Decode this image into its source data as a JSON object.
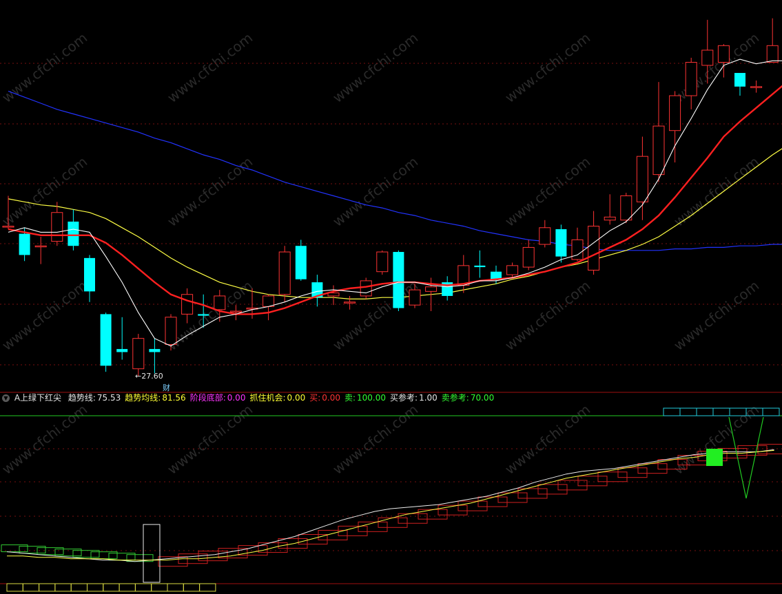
{
  "indicator": {
    "name": "A上绿下红尖",
    "items": [
      {
        "label": "趋势线:",
        "value": "75.53",
        "color": "#e6e6e6"
      },
      {
        "label": "趋势均线:",
        "value": "81.56",
        "color": "#ffff33"
      },
      {
        "label": "阶段底部:",
        "value": "0.00",
        "color": "#ff33ff"
      },
      {
        "label": "抓住机会:",
        "value": "0.00",
        "color": "#ffff33"
      },
      {
        "label": "买:",
        "value": "0.00",
        "color": "#ff3333"
      },
      {
        "label": "卖:",
        "value": "100.00",
        "color": "#33ff33"
      },
      {
        "label": "买参考:",
        "value": "1.00",
        "color": "#e6e6e6"
      },
      {
        "label": "卖参考:",
        "value": "70.00",
        "color": "#33ff33"
      }
    ]
  },
  "annotations": {
    "low_label": "←27.60",
    "finance_marker": "财"
  },
  "watermark": "www.cfchi.com",
  "colors": {
    "up": "#ff3333",
    "down": "#00ffff",
    "ma_fast": "#ffffff",
    "ma_mid": "#ff2020",
    "ma_slow": "#ffff44",
    "ma_long": "#2233ff",
    "grid": "#7a1010"
  },
  "chart_data": [
    {
      "type": "candlestick",
      "title": "",
      "y_range": [
        27.0,
        51.5
      ],
      "low_annotation": 27.6,
      "candles": [
        {
          "o": 37.5,
          "c": 37.5,
          "h": 39.5,
          "l": 37.3
        },
        {
          "o": 37.0,
          "c": 35.6,
          "h": 37.4,
          "l": 35.2
        },
        {
          "o": 36.2,
          "c": 36.2,
          "h": 36.8,
          "l": 35.0
        },
        {
          "o": 36.5,
          "c": 38.4,
          "h": 39.1,
          "l": 36.2
        },
        {
          "o": 37.8,
          "c": 36.2,
          "h": 38.6,
          "l": 35.9
        },
        {
          "o": 35.4,
          "c": 33.2,
          "h": 35.6,
          "l": 32.5
        },
        {
          "o": 31.7,
          "c": 28.3,
          "h": 31.8,
          "l": 27.9
        },
        {
          "o": 29.4,
          "c": 29.2,
          "h": 31.5,
          "l": 28.7
        },
        {
          "o": 28.1,
          "c": 30.1,
          "h": 30.4,
          "l": 27.6
        },
        {
          "o": 29.4,
          "c": 29.2,
          "h": 30.1,
          "l": 27.8
        },
        {
          "o": 29.7,
          "c": 31.5,
          "h": 31.7,
          "l": 29.3
        },
        {
          "o": 31.7,
          "c": 33.0,
          "h": 33.4,
          "l": 31.1
        },
        {
          "o": 31.7,
          "c": 31.6,
          "h": 33.0,
          "l": 30.8
        },
        {
          "o": 32.0,
          "c": 32.9,
          "h": 33.3,
          "l": 31.2
        },
        {
          "o": 31.9,
          "c": 31.9,
          "h": 32.3,
          "l": 31.3
        },
        {
          "o": 32.1,
          "c": 32.1,
          "h": 33.4,
          "l": 31.4
        },
        {
          "o": 32.2,
          "c": 32.9,
          "h": 33.0,
          "l": 31.3
        },
        {
          "o": 33.0,
          "c": 35.8,
          "h": 36.2,
          "l": 32.5
        },
        {
          "o": 36.2,
          "c": 34.0,
          "h": 36.6,
          "l": 33.9
        },
        {
          "o": 33.8,
          "c": 32.8,
          "h": 34.3,
          "l": 32.2
        },
        {
          "o": 32.9,
          "c": 33.1,
          "h": 33.6,
          "l": 32.3
        },
        {
          "o": 32.5,
          "c": 32.5,
          "h": 32.9,
          "l": 32.0
        },
        {
          "o": 32.9,
          "c": 33.9,
          "h": 34.1,
          "l": 32.7
        },
        {
          "o": 34.5,
          "c": 35.8,
          "h": 35.9,
          "l": 34.3
        },
        {
          "o": 35.8,
          "c": 32.1,
          "h": 35.9,
          "l": 31.9
        },
        {
          "o": 32.3,
          "c": 33.3,
          "h": 33.7,
          "l": 32.1
        },
        {
          "o": 33.2,
          "c": 33.5,
          "h": 34.1,
          "l": 31.9
        },
        {
          "o": 33.8,
          "c": 32.9,
          "h": 34.2,
          "l": 32.6
        },
        {
          "o": 33.6,
          "c": 34.9,
          "h": 35.6,
          "l": 33.1
        },
        {
          "o": 34.9,
          "c": 34.8,
          "h": 35.9,
          "l": 34.1
        },
        {
          "o": 34.5,
          "c": 34.0,
          "h": 34.9,
          "l": 33.7
        },
        {
          "o": 34.3,
          "c": 34.9,
          "h": 35.1,
          "l": 34.1
        },
        {
          "o": 34.8,
          "c": 36.1,
          "h": 36.6,
          "l": 34.6
        },
        {
          "o": 36.3,
          "c": 37.4,
          "h": 37.9,
          "l": 36.1
        },
        {
          "o": 37.3,
          "c": 35.5,
          "h": 37.6,
          "l": 35.1
        },
        {
          "o": 35.3,
          "c": 36.6,
          "h": 37.4,
          "l": 35.2
        },
        {
          "o": 34.6,
          "c": 37.5,
          "h": 38.5,
          "l": 34.3
        },
        {
          "o": 37.9,
          "c": 38.1,
          "h": 39.6,
          "l": 37.6
        },
        {
          "o": 37.9,
          "c": 39.5,
          "h": 39.7,
          "l": 37.7
        },
        {
          "o": 39.1,
          "c": 42.1,
          "h": 43.4,
          "l": 37.9
        },
        {
          "o": 40.9,
          "c": 44.1,
          "h": 47.0,
          "l": 40.4
        },
        {
          "o": 43.8,
          "c": 46.1,
          "h": 46.4,
          "l": 41.7
        },
        {
          "o": 46.1,
          "c": 48.3,
          "h": 48.6,
          "l": 45.2
        },
        {
          "o": 48.1,
          "c": 49.1,
          "h": 51.1,
          "l": 46.9
        },
        {
          "o": 48.3,
          "c": 49.4,
          "h": 49.5,
          "l": 47.3
        },
        {
          "o": 47.6,
          "c": 46.7,
          "h": 47.5,
          "l": 46.1
        },
        {
          "o": 46.7,
          "c": 46.7,
          "h": 47.1,
          "l": 46.3
        },
        {
          "o": 48.3,
          "c": 49.4,
          "h": 51.2,
          "l": 48.3
        },
        {
          "o": 48.9,
          "c": 48.7,
          "h": 48.9,
          "l": 48.3
        }
      ],
      "ma_fast": [
        37.1,
        37.4,
        37.1,
        37.1,
        37.3,
        37.1,
        35.5,
        33.8,
        31.8,
        30.1,
        29.6,
        30.3,
        30.9,
        31.5,
        31.7,
        32.0,
        32.2,
        32.5,
        32.9,
        33.2,
        33.3,
        33.2,
        33.1,
        33.5,
        33.8,
        33.8,
        33.6,
        33.5,
        33.6,
        33.9,
        33.9,
        34.1,
        34.4,
        34.8,
        35.3,
        35.6,
        36.4,
        37.2,
        37.8,
        38.9,
        40.6,
        42.8,
        44.6,
        46.5,
        48.1,
        48.5,
        48.2,
        48.4,
        48.4
      ],
      "ma_mid": [
        37.3,
        37.1,
        36.9,
        36.9,
        36.9,
        36.9,
        36.4,
        35.6,
        34.7,
        33.8,
        33.0,
        32.6,
        32.3,
        31.9,
        31.7,
        31.7,
        31.8,
        32.1,
        32.5,
        32.9,
        33.2,
        33.4,
        33.5,
        33.7,
        33.8,
        33.8,
        33.7,
        33.6,
        33.7,
        33.9,
        34.0,
        34.1,
        34.3,
        34.5,
        34.8,
        35.1,
        35.6,
        36.1,
        36.6,
        37.3,
        38.2,
        39.4,
        40.7,
        42.0,
        43.4,
        44.4,
        45.3,
        46.2,
        47.1
      ],
      "ma_slow": [
        39.3,
        39.1,
        38.9,
        38.8,
        38.6,
        38.4,
        38.0,
        37.4,
        36.8,
        36.1,
        35.4,
        34.8,
        34.3,
        33.8,
        33.5,
        33.2,
        33.0,
        32.9,
        32.8,
        32.8,
        32.8,
        32.7,
        32.7,
        32.8,
        32.8,
        32.9,
        33.0,
        33.1,
        33.3,
        33.5,
        33.7,
        34.0,
        34.2,
        34.5,
        34.8,
        35.0,
        35.3,
        35.6,
        35.9,
        36.3,
        36.8,
        37.5,
        38.2,
        39.0,
        39.8,
        40.6,
        41.4,
        42.2,
        42.9
      ],
      "ma_long": [
        46.4,
        46.0,
        45.6,
        45.2,
        44.9,
        44.6,
        44.3,
        44.0,
        43.7,
        43.3,
        43.0,
        42.6,
        42.2,
        41.9,
        41.5,
        41.2,
        40.8,
        40.4,
        40.1,
        39.8,
        39.5,
        39.2,
        38.9,
        38.7,
        38.4,
        38.2,
        37.9,
        37.7,
        37.5,
        37.2,
        37.0,
        36.8,
        36.6,
        36.5,
        36.3,
        36.2,
        36.0,
        35.9,
        35.9,
        35.9,
        35.9,
        36.0,
        36.0,
        36.1,
        36.1,
        36.2,
        36.2,
        36.3,
        36.3
      ]
    },
    {
      "type": "line",
      "title": "A上绿下红尖",
      "y_range": [
        -20,
        100
      ],
      "series": [
        {
          "name": "趋势线",
          "values": [
            2,
            1,
            0,
            -1,
            -2,
            -3,
            -4,
            -4,
            -5,
            -4,
            -3,
            -2,
            -1,
            0,
            2,
            4,
            7,
            10,
            13,
            17,
            21,
            25,
            28,
            31,
            33,
            34,
            35,
            36,
            38,
            40,
            42,
            45,
            48,
            52,
            55,
            58,
            60,
            61,
            62,
            64,
            66,
            68,
            70,
            72,
            73,
            74,
            74,
            74,
            75.53
          ]
        },
        {
          "name": "趋势均线",
          "values": [
            -1,
            -1,
            -2,
            -2,
            -3,
            -3,
            -3,
            -4,
            -4,
            -4,
            -4,
            -3,
            -3,
            -2,
            -1,
            1,
            3,
            6,
            8,
            11,
            14,
            17,
            20,
            23,
            26,
            29,
            31,
            33,
            35,
            37,
            40,
            43,
            46,
            49,
            52,
            55,
            57,
            59,
            61,
            63,
            65,
            67,
            69,
            70,
            72,
            73,
            73,
            74,
            75
          ]
        }
      ],
      "boxes": [
        -5,
        -3,
        -1,
        1,
        3,
        5,
        8,
        11,
        14,
        17,
        20,
        23,
        26,
        29,
        32,
        35,
        38,
        41,
        44,
        47,
        50,
        53,
        56,
        59,
        62,
        65,
        68,
        71,
        73,
        75,
        76
      ],
      "sell_marker": {
        "x_index": 43,
        "value": 70
      },
      "buy_tower": {
        "x_index": 8,
        "value": 100
      },
      "sell_spike": {
        "x_index": 45,
        "top": 100,
        "bottom": 38
      }
    }
  ]
}
